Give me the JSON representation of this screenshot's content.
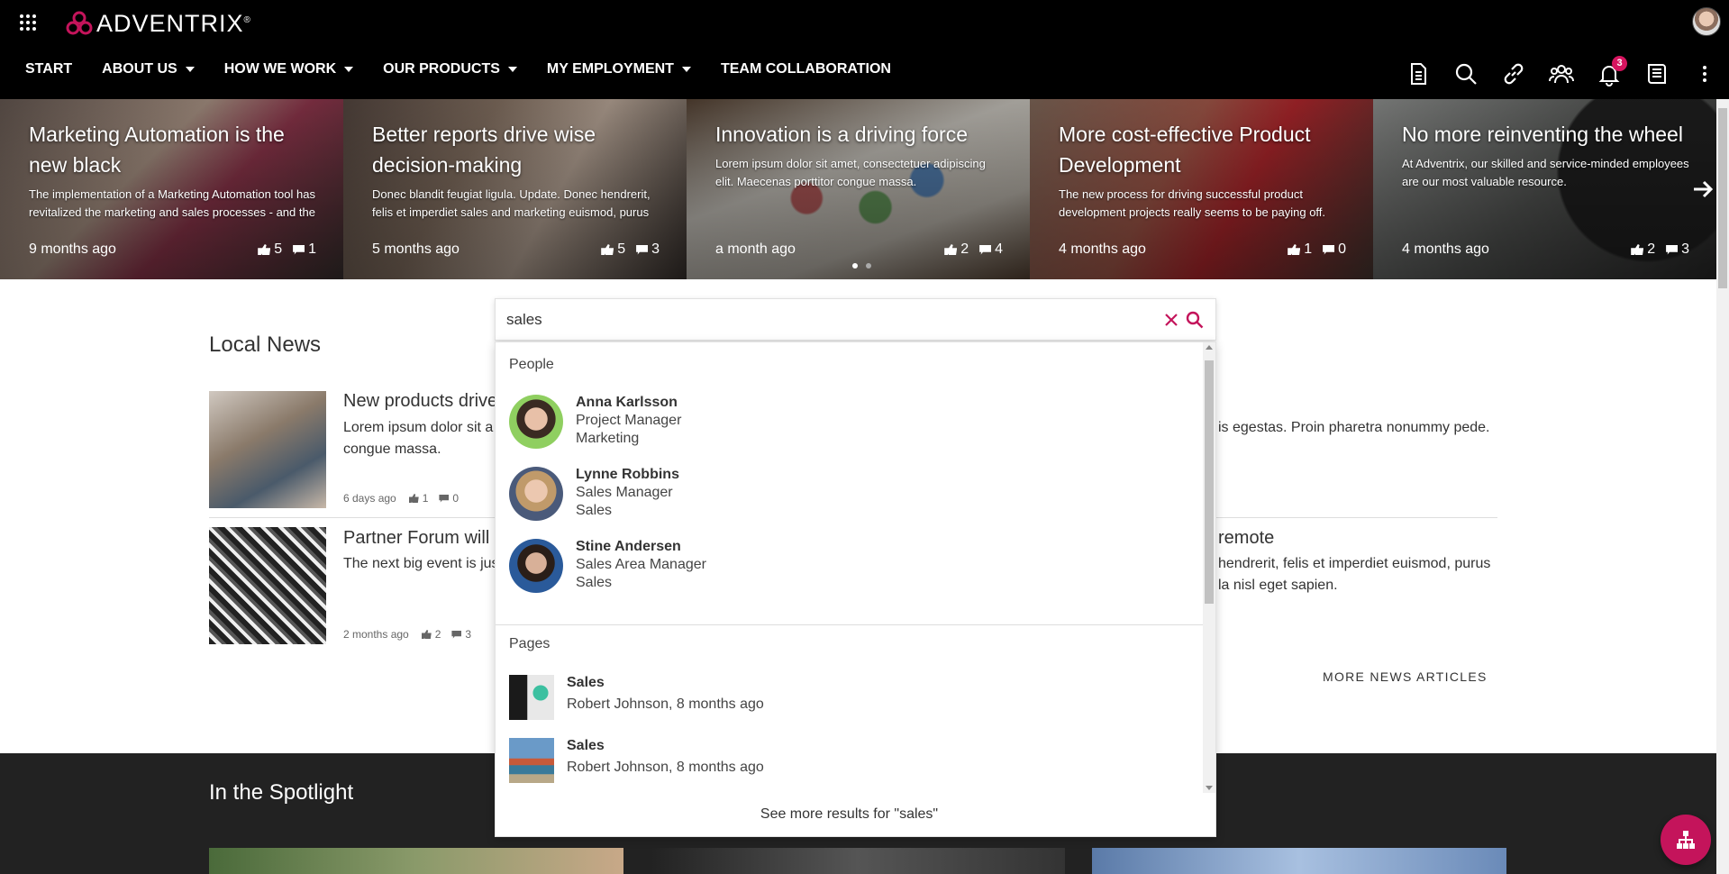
{
  "brand": {
    "name": "ADVENTRIX",
    "trademark": "®"
  },
  "nav": {
    "items": [
      {
        "label": "START",
        "dropdown": false
      },
      {
        "label": "ABOUT US",
        "dropdown": true
      },
      {
        "label": "HOW WE WORK",
        "dropdown": true
      },
      {
        "label": "OUR PRODUCTS",
        "dropdown": true
      },
      {
        "label": "MY EMPLOYMENT",
        "dropdown": true
      },
      {
        "label": "TEAM COLLABORATION",
        "dropdown": false
      }
    ]
  },
  "toolbar": {
    "icons": [
      "document-icon",
      "search-icon",
      "link-icon",
      "people-icon",
      "bell-icon",
      "book-icon",
      "more-vertical-icon"
    ],
    "notification_count": "3"
  },
  "carousel": {
    "slides": [
      {
        "title": "Marketing Automation is the new black",
        "text": "The implementation of a Marketing Automation tool has revitalized the marketing and sales processes - and the we now see growth in double digits.",
        "date": "9 months ago",
        "likes": "5",
        "comments": "1"
      },
      {
        "title": "Better reports drive wise decision-making",
        "text": "Donec blandit feugiat ligula. Update. Donec hendrerit, felis et imperdiet sales and marketing euismod, purus ipsum pretium metus, in lacinia nulla nisl eget sapien.",
        "date": "5 months ago",
        "likes": "5",
        "comments": "3"
      },
      {
        "title": "Innovation is a driving force",
        "text": "Lorem ipsum dolor sit amet, consectetuer adipiscing elit. Maecenas porttitor congue massa.",
        "date": "a month ago",
        "likes": "2",
        "comments": "4"
      },
      {
        "title": "More cost-effective Product Development",
        "text": "The new process for driving successful product development projects really seems to be paying off.",
        "date": "4 months ago",
        "likes": "1",
        "comments": "0"
      },
      {
        "title": "No more reinventing the wheel",
        "text": "At Adventrix, our skilled and service-minded employees are our most valuable resource.",
        "date": "4 months ago",
        "likes": "2",
        "comments": "3"
      }
    ]
  },
  "local_news": {
    "title": "Local News",
    "items": [
      {
        "title": "New products drive",
        "text": "Lorem ipsum dolor sit a",
        "text2": "congue massa.",
        "date": "6 days ago",
        "likes": "1",
        "comments": "0"
      },
      {
        "title": "Partner Forum will",
        "text": "The next big event is jus",
        "date": "2 months ago",
        "likes": "2",
        "comments": "3"
      }
    ],
    "right_fragments": {
      "first_text": "is egestas. Proin pharetra nonummy pede.",
      "second_title": "remote",
      "second_text1": "hendrerit, felis et imperdiet euismod, purus",
      "second_text2": "la nisl eget sapien."
    },
    "more_label": "MORE NEWS ARTICLES"
  },
  "spotlight": {
    "title": "In the Spotlight"
  },
  "search": {
    "query": "sales",
    "people_label": "People",
    "people": [
      {
        "name": "Anna Karlsson",
        "role": "Project Manager",
        "dept": "Marketing"
      },
      {
        "name": "Lynne Robbins",
        "role": "Sales Manager",
        "dept": "Sales"
      },
      {
        "name": "Stine Andersen",
        "role": "Sales Area Manager",
        "dept": "Sales"
      }
    ],
    "pages_label": "Pages",
    "pages": [
      {
        "title": "Sales",
        "meta": "Robert Johnson, 8 months ago"
      },
      {
        "title": "Sales",
        "meta": "Robert Johnson, 8 months ago"
      }
    ],
    "see_more": "See more results for \"sales\""
  },
  "colors": {
    "accent": "#c4145b",
    "topbar": "#000000",
    "spotlight_bg": "#222222"
  }
}
